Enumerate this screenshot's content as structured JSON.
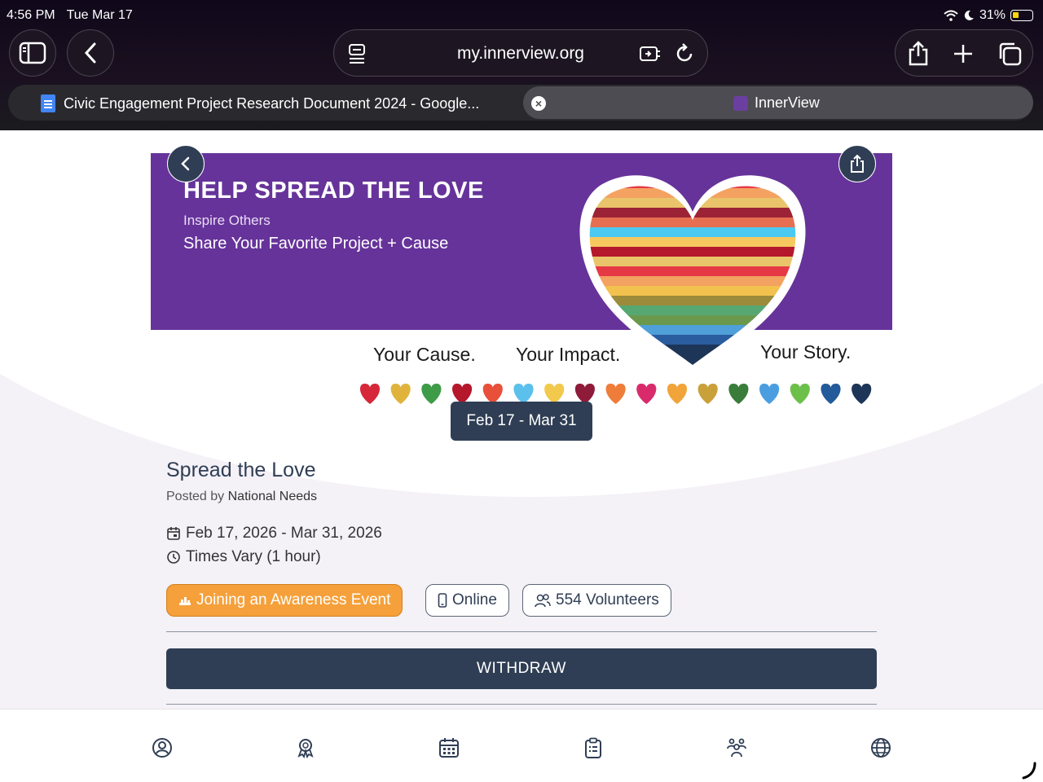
{
  "status_bar": {
    "time": "4:56 PM",
    "date": "Tue Mar 17",
    "battery": "31%"
  },
  "browser": {
    "url": "my.innerview.org",
    "tabs": [
      {
        "label": "Civic Engagement Project Research Document 2024 - Google..."
      },
      {
        "label": "InnerView"
      }
    ]
  },
  "banner": {
    "title": "HELP SPREAD THE LOVE",
    "subtitle1": "Inspire Others",
    "subtitle2": "Share Your Favorite Project + Cause",
    "tag1": "Your Cause.",
    "tag2": "Your Impact.",
    "tag3": "Your Story.",
    "date_badge": "Feb 17 - Mar 31"
  },
  "event": {
    "title": "Spread the Love",
    "posted_by_prefix": "Posted by",
    "posted_by": "National Needs",
    "date_range": "Feb 17, 2026 - Mar 31, 2026",
    "time": "Times Vary (1 hour)",
    "chips": {
      "category": "Joining an Awareness Event",
      "mode": "Online",
      "volunteers": "554 Volunteers"
    },
    "withdraw_label": "WITHDRAW"
  },
  "colors": {
    "banner_purple": "#66339a",
    "navy": "#2f3e54",
    "orange": "#f5a03a"
  },
  "bottom_nav": [
    "profile-icon",
    "award-icon",
    "calendar-icon",
    "clipboard-icon",
    "group-icon",
    "globe-icon"
  ]
}
